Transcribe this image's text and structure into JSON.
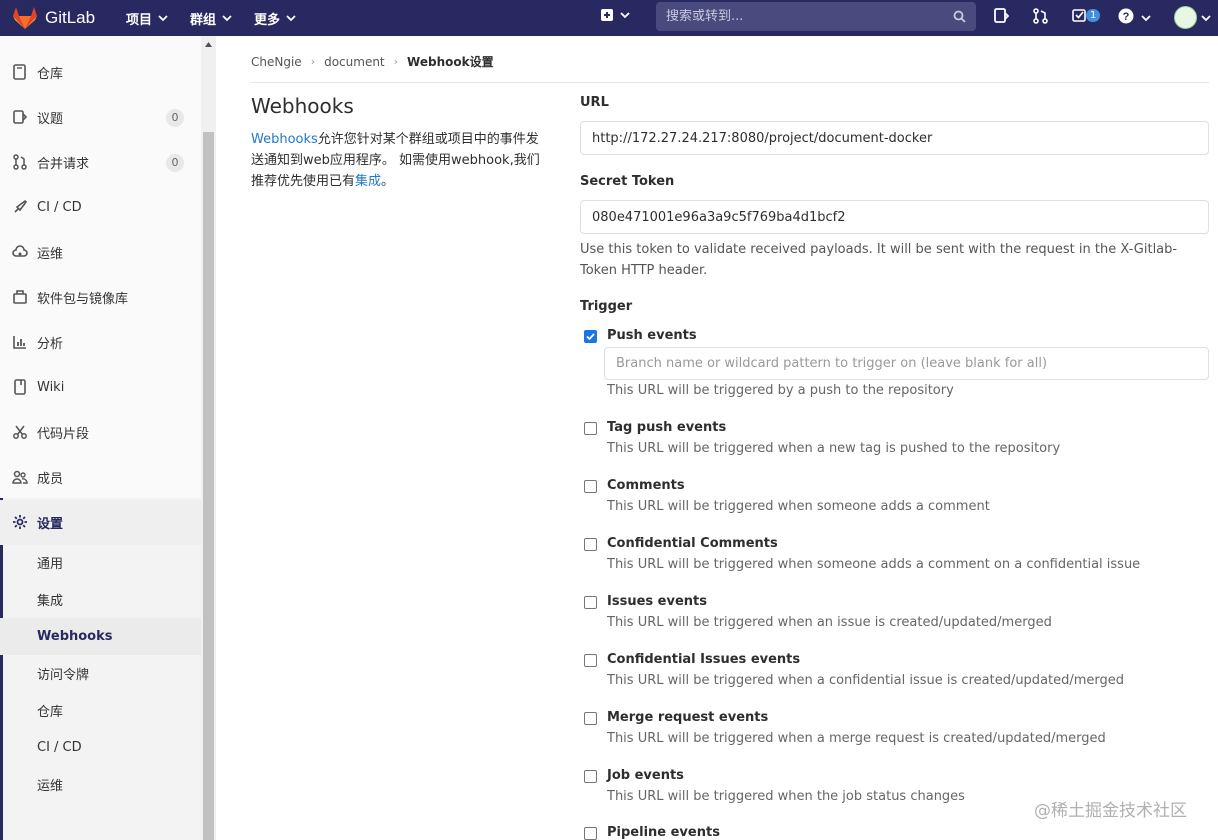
{
  "topbar": {
    "brand": "GitLab",
    "menus": [
      "项目",
      "群组",
      "更多"
    ],
    "search_placeholder": "搜索或转到...",
    "todo_count": "1"
  },
  "sidebar": {
    "items": [
      {
        "label": "仓库",
        "icon": "repository-icon"
      },
      {
        "label": "议题",
        "icon": "issues-icon",
        "count": "0"
      },
      {
        "label": "合并请求",
        "icon": "merge-request-icon",
        "count": "0"
      },
      {
        "label": "CI / CD",
        "icon": "rocket-icon"
      },
      {
        "label": "运维",
        "icon": "cloud-gear-icon"
      },
      {
        "label": "软件包与镜像库",
        "icon": "package-icon"
      },
      {
        "label": "分析",
        "icon": "chart-icon"
      },
      {
        "label": "Wiki",
        "icon": "book-icon"
      },
      {
        "label": "代码片段",
        "icon": "scissors-icon"
      },
      {
        "label": "成员",
        "icon": "users-icon"
      },
      {
        "label": "设置",
        "icon": "gear-icon"
      }
    ],
    "sub_items": [
      "通用",
      "集成",
      "Webhooks",
      "访问令牌",
      "仓库",
      "CI / CD",
      "运维"
    ]
  },
  "breadcrumb": [
    "CheNgie",
    "document",
    "Webhook设置"
  ],
  "page": {
    "title": "Webhooks",
    "desc_link": "Webhooks",
    "desc_text": "允许您针对某个群组或项目中的事件发送通知到web应用程序。 如需使用webhook,我们推荐优先使用已有",
    "desc_link2": "集成",
    "desc_end": "。"
  },
  "form": {
    "url_label": "URL",
    "url_value": "http://172.27.24.217:8080/project/document-docker",
    "token_label": "Secret Token",
    "token_value": "080e471001e96a3a9c5f769ba4d1bcf2",
    "token_help": "Use this token to validate received payloads. It will be sent with the request in the X-Gitlab-Token HTTP header.",
    "trigger_label": "Trigger",
    "branch_placeholder": "Branch name or wildcard pattern to trigger on (leave blank for all)",
    "triggers": [
      {
        "label": "Push events",
        "help": "This URL will be triggered by a push to the repository",
        "checked": true
      },
      {
        "label": "Tag push events",
        "help": "This URL will be triggered when a new tag is pushed to the repository",
        "checked": false
      },
      {
        "label": "Comments",
        "help": "This URL will be triggered when someone adds a comment",
        "checked": false
      },
      {
        "label": "Confidential Comments",
        "help": "This URL will be triggered when someone adds a comment on a confidential issue",
        "checked": false
      },
      {
        "label": "Issues events",
        "help": "This URL will be triggered when an issue is created/updated/merged",
        "checked": false
      },
      {
        "label": "Confidential Issues events",
        "help": "This URL will be triggered when a confidential issue is created/updated/merged",
        "checked": false
      },
      {
        "label": "Merge request events",
        "help": "This URL will be triggered when a merge request is created/updated/merged",
        "checked": false
      },
      {
        "label": "Job events",
        "help": "This URL will be triggered when the job status changes",
        "checked": false
      },
      {
        "label": "Pipeline events",
        "help": "",
        "checked": false
      }
    ]
  },
  "watermark": "@稀土掘金技术社区",
  "colors": {
    "navbar": "#292961",
    "link": "#1f78d1",
    "checkbox": "#1a73e8"
  }
}
